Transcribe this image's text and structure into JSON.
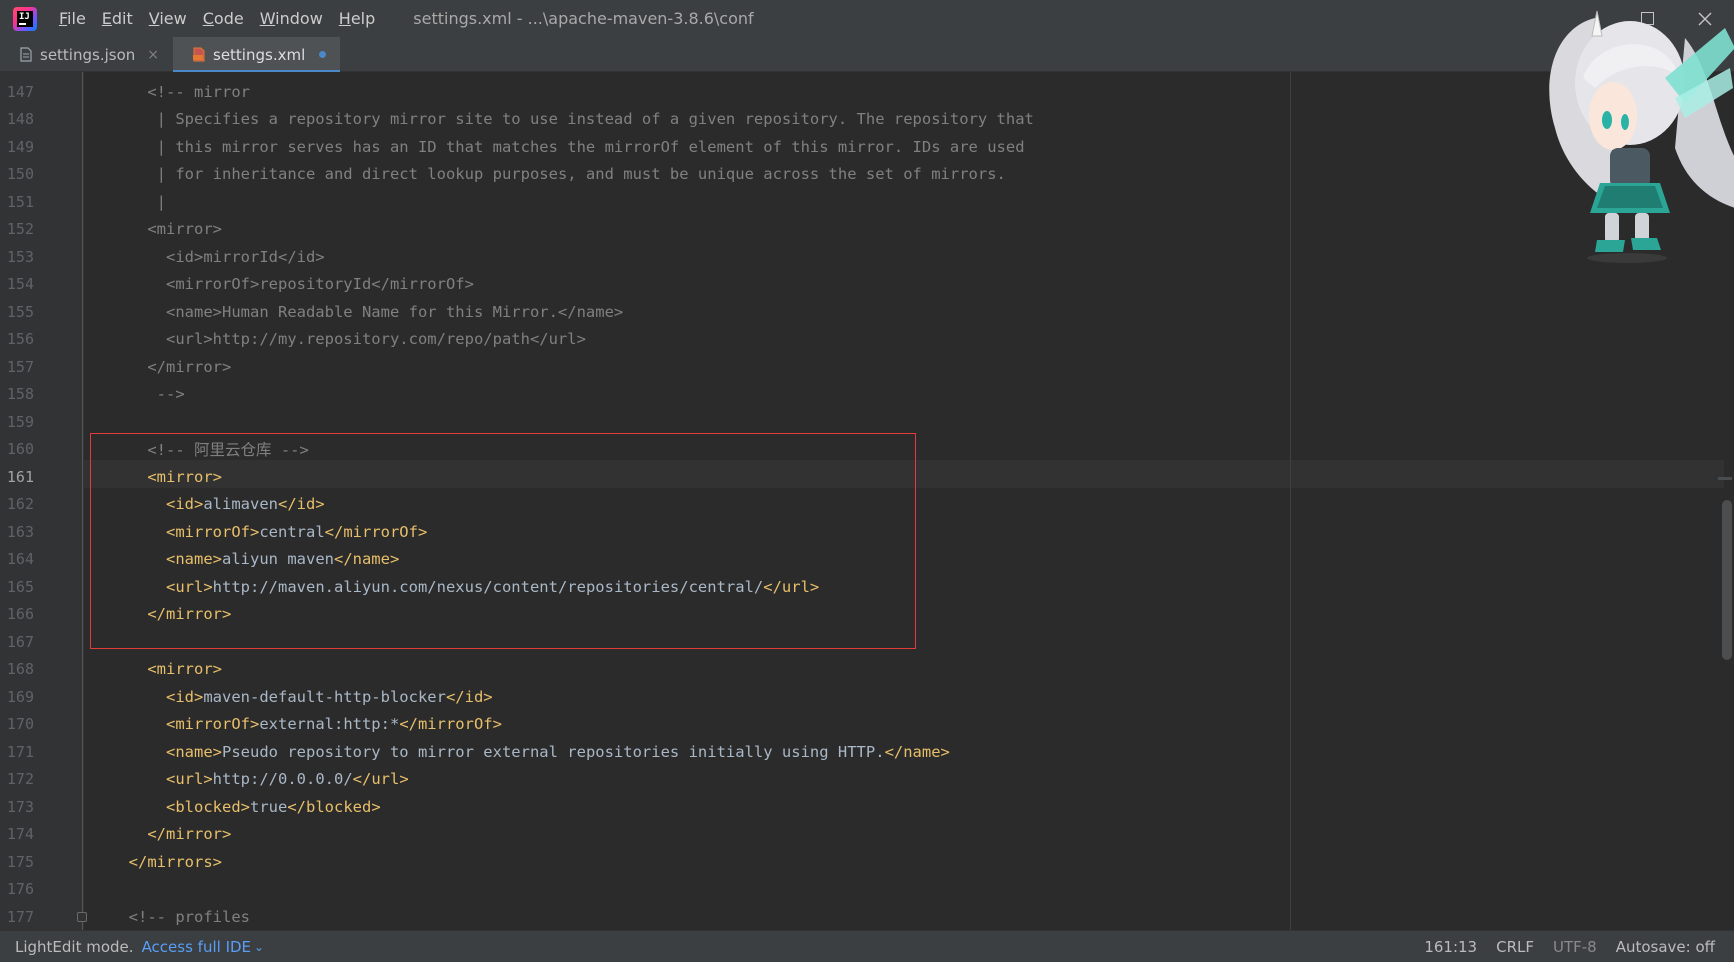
{
  "menu": {
    "items": [
      {
        "first": "F",
        "rest": "ile"
      },
      {
        "first": "E",
        "rest": "dit"
      },
      {
        "first": "V",
        "rest": "iew"
      },
      {
        "first": "C",
        "rest": "ode"
      },
      {
        "first": "W",
        "rest": "indow"
      },
      {
        "first": "H",
        "rest": "elp"
      }
    ],
    "window_title": "settings.xml - ...\\apache-maven-3.8.6\\conf"
  },
  "tabs": [
    {
      "label": "settings.json",
      "close": "×"
    },
    {
      "label": "settings.xml"
    }
  ],
  "editor": {
    "lines": [
      {
        "n": "147",
        "indent": "    ",
        "parts": [
          [
            "c-comment",
            "<!-- mirror"
          ]
        ]
      },
      {
        "n": "148",
        "indent": "     ",
        "parts": [
          [
            "c-comment",
            "| Specifies a repository mirror site to use instead of a given repository. The repository that"
          ]
        ]
      },
      {
        "n": "149",
        "indent": "     ",
        "parts": [
          [
            "c-comment",
            "| this mirror serves has an ID that matches the mirrorOf element of this mirror. IDs are used"
          ]
        ]
      },
      {
        "n": "150",
        "indent": "     ",
        "parts": [
          [
            "c-comment",
            "| for inheritance and direct lookup purposes, and must be unique across the set of mirrors."
          ]
        ]
      },
      {
        "n": "151",
        "indent": "     ",
        "parts": [
          [
            "c-comment",
            "|"
          ]
        ]
      },
      {
        "n": "152",
        "indent": "    ",
        "parts": [
          [
            "c-comment",
            "<mirror>"
          ]
        ]
      },
      {
        "n": "153",
        "indent": "      ",
        "parts": [
          [
            "c-comment",
            "<id>mirrorId</id>"
          ]
        ]
      },
      {
        "n": "154",
        "indent": "      ",
        "parts": [
          [
            "c-comment",
            "<mirrorOf>repositoryId</mirrorOf>"
          ]
        ]
      },
      {
        "n": "155",
        "indent": "      ",
        "parts": [
          [
            "c-comment",
            "<name>Human Readable Name for this Mirror.</name>"
          ]
        ]
      },
      {
        "n": "156",
        "indent": "      ",
        "parts": [
          [
            "c-comment",
            "<url>http://my.repository.com/repo/path</url>"
          ]
        ]
      },
      {
        "n": "157",
        "indent": "    ",
        "parts": [
          [
            "c-comment",
            "</mirror>"
          ]
        ]
      },
      {
        "n": "158",
        "indent": "     ",
        "parts": [
          [
            "c-comment",
            "-->"
          ]
        ]
      },
      {
        "n": "159",
        "indent": "",
        "parts": []
      },
      {
        "n": "160",
        "indent": "    ",
        "parts": [
          [
            "c-comment",
            "<!-- 阿里云仓库 -->"
          ]
        ]
      },
      {
        "n": "161",
        "indent": "    ",
        "parts": [
          [
            "c-tag",
            "<mirror>"
          ]
        ]
      },
      {
        "n": "162",
        "indent": "      ",
        "parts": [
          [
            "c-tag",
            "<id>"
          ],
          [
            "c-text",
            "alimaven"
          ],
          [
            "c-tag",
            "</id>"
          ]
        ]
      },
      {
        "n": "163",
        "indent": "      ",
        "parts": [
          [
            "c-tag",
            "<mirrorOf>"
          ],
          [
            "c-text",
            "central"
          ],
          [
            "c-tag",
            "</mirrorOf>"
          ]
        ]
      },
      {
        "n": "164",
        "indent": "      ",
        "parts": [
          [
            "c-tag",
            "<name>"
          ],
          [
            "c-text",
            "aliyun maven"
          ],
          [
            "c-tag",
            "</name>"
          ]
        ]
      },
      {
        "n": "165",
        "indent": "      ",
        "parts": [
          [
            "c-tag",
            "<url>"
          ],
          [
            "c-text",
            "http://maven.aliyun.com/nexus/content/repositories/central/"
          ],
          [
            "c-tag",
            "</url>"
          ]
        ]
      },
      {
        "n": "166",
        "indent": "    ",
        "parts": [
          [
            "c-tag",
            "</mirror>"
          ]
        ]
      },
      {
        "n": "167",
        "indent": "",
        "parts": []
      },
      {
        "n": "168",
        "indent": "    ",
        "parts": [
          [
            "c-tag",
            "<mirror>"
          ]
        ]
      },
      {
        "n": "169",
        "indent": "      ",
        "parts": [
          [
            "c-tag",
            "<id>"
          ],
          [
            "c-text",
            "maven-default-http-blocker"
          ],
          [
            "c-tag",
            "</id>"
          ]
        ]
      },
      {
        "n": "170",
        "indent": "      ",
        "parts": [
          [
            "c-tag",
            "<mirrorOf>"
          ],
          [
            "c-text",
            "external:http:*"
          ],
          [
            "c-tag",
            "</mirrorOf>"
          ]
        ]
      },
      {
        "n": "171",
        "indent": "      ",
        "parts": [
          [
            "c-tag",
            "<name>"
          ],
          [
            "c-text",
            "Pseudo repository to mirror external repositories initially using HTTP."
          ],
          [
            "c-tag",
            "</name>"
          ]
        ]
      },
      {
        "n": "172",
        "indent": "      ",
        "parts": [
          [
            "c-tag",
            "<url>"
          ],
          [
            "c-text",
            "http://0.0.0.0/"
          ],
          [
            "c-tag",
            "</url>"
          ]
        ]
      },
      {
        "n": "173",
        "indent": "      ",
        "parts": [
          [
            "c-tag",
            "<blocked>"
          ],
          [
            "c-text",
            "true"
          ],
          [
            "c-tag",
            "</blocked>"
          ]
        ]
      },
      {
        "n": "174",
        "indent": "    ",
        "parts": [
          [
            "c-tag",
            "</mirror>"
          ]
        ]
      },
      {
        "n": "175",
        "indent": "  ",
        "parts": [
          [
            "c-tag",
            "</mirrors>"
          ]
        ]
      },
      {
        "n": "176",
        "indent": "",
        "parts": []
      },
      {
        "n": "177",
        "indent": "  ",
        "parts": [
          [
            "c-comment",
            "<!-- profiles"
          ]
        ]
      }
    ],
    "current_line": "161"
  },
  "status": {
    "mode": "LightEdit mode.",
    "access_link": "Access full IDE",
    "position": "161:13",
    "line_ending": "CRLF",
    "encoding": "UTF-8",
    "autosave": "Autosave: off"
  },
  "colors": {
    "highlight_box": "#e03c3c",
    "tag": "#e8bf6a",
    "comment": "#808080",
    "text": "#a9b7c6"
  }
}
